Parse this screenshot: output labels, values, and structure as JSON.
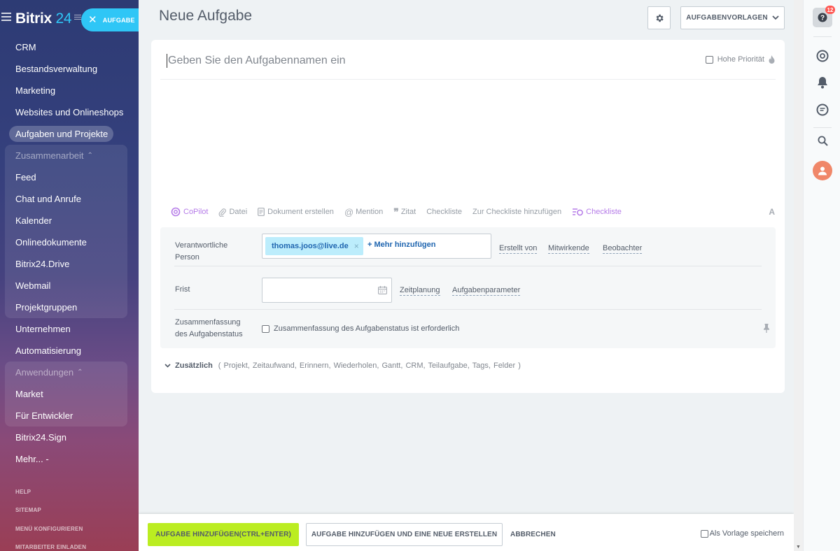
{
  "sidebar": {
    "logo_main": "Bitrix",
    "logo_num": "24",
    "task_button": "AUFGABE",
    "items_top": [
      {
        "label": "CRM"
      },
      {
        "label": "Bestandsverwaltung"
      },
      {
        "label": "Marketing"
      },
      {
        "label": "Websites und Onlineshops"
      },
      {
        "label": "Aufgaben und Projekte"
      }
    ],
    "group1": {
      "title": "Zusammenarbeit",
      "items": [
        {
          "label": "Feed"
        },
        {
          "label": "Chat und Anrufe"
        },
        {
          "label": "Kalender"
        },
        {
          "label": "Onlinedokumente"
        },
        {
          "label": "Bitrix24.Drive"
        },
        {
          "label": "Webmail"
        },
        {
          "label": "Projektgruppen"
        }
      ]
    },
    "items_mid": [
      {
        "label": "Unternehmen"
      },
      {
        "label": "Automatisierung"
      }
    ],
    "group2": {
      "title": "Anwendungen",
      "items": [
        {
          "label": "Market"
        },
        {
          "label": "Für Entwickler"
        }
      ]
    },
    "items_bottom": [
      {
        "label": "Bitrix24.Sign"
      }
    ],
    "more": "Mehr... ",
    "more_suffix": "-",
    "footer": [
      "HELP",
      "SITEMAP",
      "MENÜ KONFIGURIEREN",
      "MITARBEITER EINLADEN"
    ]
  },
  "header": {
    "title": "Neue Aufgabe",
    "templates_button": "AUFGABENVORLAGEN"
  },
  "form": {
    "title_placeholder": "Geben Sie den Aufgabennamen ein",
    "priority_label": "Hohe Priorität",
    "toolbar": [
      "CoPilot",
      "Datei",
      "Dokument erstellen",
      "Mention",
      "Zitat",
      "Checkliste",
      "Zur Checkliste hinzufügen",
      "Checkliste"
    ],
    "toolbar_font": "A",
    "responsible_label_1": "Verantwortliche",
    "responsible_label_2": "Person",
    "responsible_tag": "thomas.joos@live.de",
    "add_more": "Mehr hinzufügen",
    "created_by": "Erstellt von",
    "participants": "Mitwirkende",
    "observers": "Beobachter",
    "deadline_label": "Frist",
    "scheduling": "Zeitplanung",
    "task_params": "Aufgabenparameter",
    "summary_label_1": "Zusammenfassung",
    "summary_label_2": "des Aufgabenstatus",
    "summary_checkbox": "Zusammenfassung des Aufgabenstatus ist erforderlich",
    "extra_label": "Zusätzlich",
    "extra_options": "( Projekt, Zeitaufwand, Erinnern, Wiederholen, Gantt, CRM, Teilaufgabe, Tags, Felder )"
  },
  "footer_bar": {
    "add_button": "AUFGABE HINZUFÜGEN(CTRL+ENTER)",
    "add_new_button": "AUFGABE HINZUFÜGEN UND EINE NEUE ERSTELLEN",
    "cancel_button": "ABBRECHEN",
    "save_template": "Als Vorlage speichern"
  },
  "right_panel": {
    "help_badge": "12"
  },
  "colors": {
    "accent": "#2fc6f6",
    "primary_button": "#bbed21",
    "link": "#2066b0",
    "copilot": "#b57be8"
  }
}
